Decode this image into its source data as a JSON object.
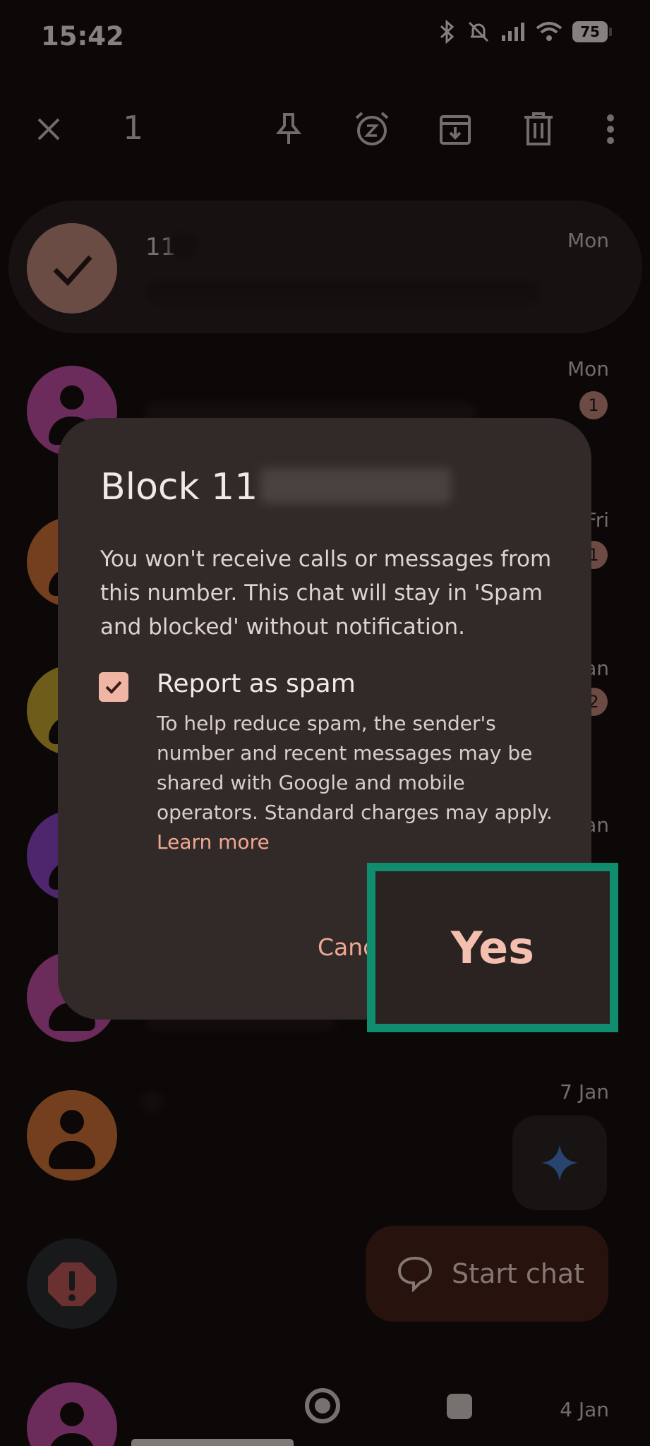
{
  "status": {
    "time": "15:42",
    "battery": "75"
  },
  "toolbar": {
    "selected_count": "1"
  },
  "conversations": [
    {
      "name": "11",
      "time": "Mon",
      "badge": "",
      "avatar_color": "#c48a7e",
      "selected": true
    },
    {
      "name": "",
      "time": "Mon",
      "badge": "1",
      "avatar_color": "#c44fa7"
    },
    {
      "name": "",
      "time": "Fri",
      "badge": "1",
      "avatar_color": "#d4733a"
    },
    {
      "name": "",
      "time": "an",
      "badge": "2",
      "avatar_color": "#c8a830"
    },
    {
      "name": "",
      "time": "an",
      "badge": "",
      "avatar_color": "#8c45c6"
    },
    {
      "name": "",
      "time": "",
      "badge": "",
      "avatar_color": "#c44fa7"
    },
    {
      "name": "",
      "time": "7 Jan",
      "badge": "",
      "avatar_color": "#d4733a"
    },
    {
      "name": "",
      "time": "",
      "badge": "",
      "avatar_color": "#2c2e30"
    },
    {
      "name": "",
      "time": "4 Jan",
      "badge": "",
      "avatar_color": "#c44fa7"
    }
  ],
  "dialog": {
    "title": "Block 11",
    "body": "You won't receive calls or messages from this number. This chat will stay in 'Spam and blocked' without notification.",
    "checkbox_label": "Report as spam",
    "checkbox_desc": "To help reduce spam, the sender's number and recent messages may be shared with Google and mobile operators. Standard charges may apply.",
    "learn_more": "Learn more",
    "cancel": "Canc",
    "yes": "Yes"
  },
  "fab": {
    "start_chat": "Start chat"
  },
  "colors": {
    "accent": "#f0a893",
    "highlight": "#0f8d6e",
    "fab_bg": "#4a2219"
  }
}
